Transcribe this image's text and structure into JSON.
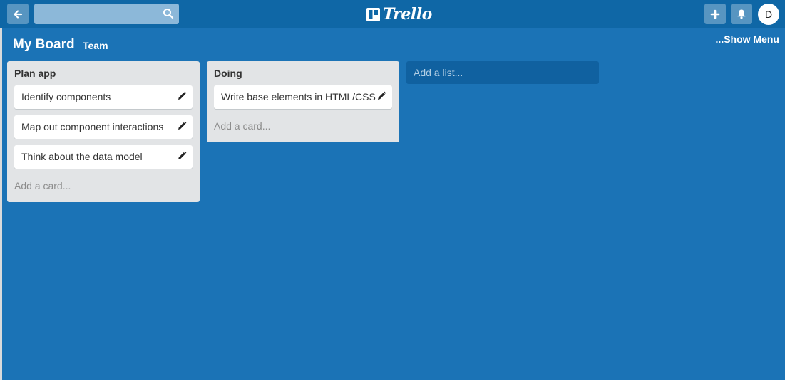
{
  "app": {
    "logo_text": "Trello"
  },
  "header": {
    "search": {
      "value": "",
      "placeholder": ""
    },
    "avatar_initial": "D"
  },
  "board": {
    "title": "My Board",
    "team_label": "Team",
    "show_menu_label": "...Show Menu"
  },
  "lists": [
    {
      "title": "Plan app",
      "cards": [
        "Identify components",
        "Map out component interactions",
        "Think about the data model"
      ],
      "add_card_label": "Add a card..."
    },
    {
      "title": "Doing",
      "cards": [
        "Write base elements in HTML/CSS"
      ],
      "add_card_label": "Add a card..."
    }
  ],
  "add_list_label": "Add a list...",
  "icons": {
    "back": "arrow-left-icon",
    "search": "search-icon",
    "add": "plus-icon",
    "notifications": "bell-icon",
    "card_edit": "pencil-icon",
    "logo": "trello-board-icon"
  },
  "colors": {
    "board_background": "#1b73b6",
    "header_background": "#0f67a6",
    "list_background": "#e2e4e6",
    "card_background": "#ffffff"
  }
}
